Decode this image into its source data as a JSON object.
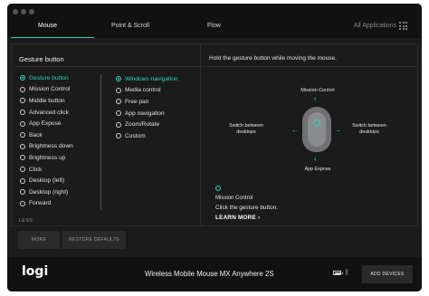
{
  "tabs": [
    {
      "label": "Mouse"
    },
    {
      "label": "Point & Scroll"
    },
    {
      "label": "Flow"
    }
  ],
  "all_applications_label": "All Applications",
  "left_panel": {
    "title": "Gesture button",
    "buttons": [
      {
        "label": "Gesture button",
        "selected": true
      },
      {
        "label": "Mission Control"
      },
      {
        "label": "Middle button"
      },
      {
        "label": "Advanced click"
      },
      {
        "label": "App Expose"
      },
      {
        "label": "Back"
      },
      {
        "label": "Brightness down"
      },
      {
        "label": "Brightness up"
      },
      {
        "label": "Click"
      },
      {
        "label": "Desktop (left)"
      },
      {
        "label": "Desktop (right)"
      },
      {
        "label": "Forward"
      }
    ],
    "actions": [
      {
        "label": "Windows navigation",
        "selected": true
      },
      {
        "label": "Media control"
      },
      {
        "label": "Free pan"
      },
      {
        "label": "App navigation"
      },
      {
        "label": "Zoom/Rotate"
      },
      {
        "label": "Custom"
      }
    ],
    "less_label": "LESS"
  },
  "right_panel": {
    "instruction": "Hold the gesture button while moving the mouse.",
    "diagram": {
      "top": "Mission Control",
      "left": "Switch between\ndesktops",
      "right": "Switch between\ndesktops",
      "bottom": "App Expose"
    },
    "tip": {
      "title": "Mission Control",
      "description": "Click the gesture button.",
      "learn_more": "LEARN MORE"
    }
  },
  "buttons": {
    "more": "MORE",
    "restore": "RESTORE DEFAULTS"
  },
  "footer": {
    "logo": "logi",
    "device_name": "Wireless Mobile Mouse MX Anywhere 2S",
    "add_devices": "ADD DEVICES",
    "battery_level": 0.8
  },
  "colors": {
    "accent": "#2bd6b6",
    "background": "#1b1b1b",
    "bar": "#111111"
  }
}
